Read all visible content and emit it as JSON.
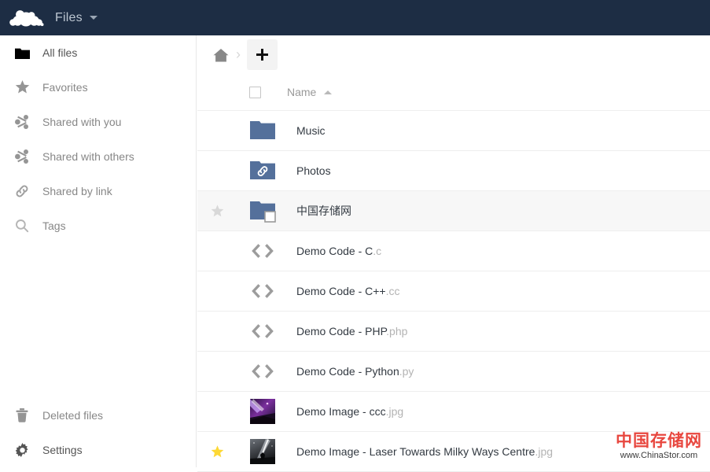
{
  "header": {
    "logo_icon": "owncloud-cloud-logo",
    "app_name": "Files",
    "app_caret_icon": "caret-down-icon",
    "background_color": "#1d2d44",
    "text_color": "#bcc6d1"
  },
  "sidebar": {
    "items": [
      {
        "id": "all-files",
        "label": "All files",
        "icon": "folder-icon",
        "active": true
      },
      {
        "id": "favorites",
        "label": "Favorites",
        "icon": "star-icon",
        "active": false
      },
      {
        "id": "shared-with-you",
        "label": "Shared with you",
        "icon": "share-icon",
        "active": false
      },
      {
        "id": "shared-with-others",
        "label": "Shared with others",
        "icon": "share-icon",
        "active": false
      },
      {
        "id": "shared-by-link",
        "label": "Shared by link",
        "icon": "link-icon",
        "active": false
      },
      {
        "id": "tags",
        "label": "Tags",
        "icon": "search-icon",
        "active": false
      }
    ],
    "bottom_items": [
      {
        "id": "deleted-files",
        "label": "Deleted files",
        "icon": "trash-icon",
        "active": false
      },
      {
        "id": "settings",
        "label": "Settings",
        "icon": "gear-icon",
        "active": true
      }
    ]
  },
  "breadcrumb": {
    "home_icon": "home-icon",
    "separator": "›",
    "new_button_label": "+",
    "new_button_icon": "plus-icon"
  },
  "table": {
    "select_all_checked": false,
    "columns": {
      "name": "Name"
    },
    "sort": {
      "column": "Name",
      "direction": "asc",
      "icon": "sort-arrow-up-icon"
    },
    "rows": [
      {
        "name": "Music",
        "extension": "",
        "icon": "folder-icon",
        "icon_kind": "folder",
        "favorite": false,
        "star_visible": false,
        "highlight": false
      },
      {
        "name": "Photos",
        "extension": "",
        "icon": "folder-shared-link-icon",
        "icon_kind": "folder-link",
        "favorite": false,
        "star_visible": false,
        "highlight": false
      },
      {
        "name": "中国存储网",
        "extension": "",
        "icon": "folder-external-icon",
        "icon_kind": "folder-external",
        "favorite": false,
        "star_visible": true,
        "highlight": true
      },
      {
        "name": "Demo Code - C",
        "extension": ".c",
        "icon": "code-file-icon",
        "icon_kind": "code",
        "favorite": false,
        "star_visible": false,
        "highlight": false
      },
      {
        "name": "Demo Code - C++",
        "extension": ".cc",
        "icon": "code-file-icon",
        "icon_kind": "code",
        "favorite": false,
        "star_visible": false,
        "highlight": false
      },
      {
        "name": "Demo Code - PHP",
        "extension": ".php",
        "icon": "code-file-icon",
        "icon_kind": "code",
        "favorite": false,
        "star_visible": false,
        "highlight": false
      },
      {
        "name": "Demo Code - Python",
        "extension": ".py",
        "icon": "code-file-icon",
        "icon_kind": "code",
        "favorite": false,
        "star_visible": false,
        "highlight": false
      },
      {
        "name": "Demo Image - ccc",
        "extension": ".jpg",
        "icon": "image-thumbnail",
        "icon_kind": "image-aurora",
        "favorite": false,
        "star_visible": false,
        "highlight": false
      },
      {
        "name": "Demo Image - Laser Towards Milky Ways Centre",
        "extension": ".jpg",
        "icon": "image-thumbnail",
        "icon_kind": "image-laser",
        "favorite": true,
        "star_visible": true,
        "highlight": false
      }
    ]
  },
  "watermark": {
    "title": "中国存储网",
    "url": "www.ChinaStor.com",
    "color": "#e8473f"
  },
  "colors": {
    "folder": "#54709b",
    "star_active": "#fdd835",
    "star_inactive": "#d8d8d8",
    "accent": "#1d2d44",
    "extension_text": "#b3b3b3",
    "filename_text": "#333a42"
  }
}
